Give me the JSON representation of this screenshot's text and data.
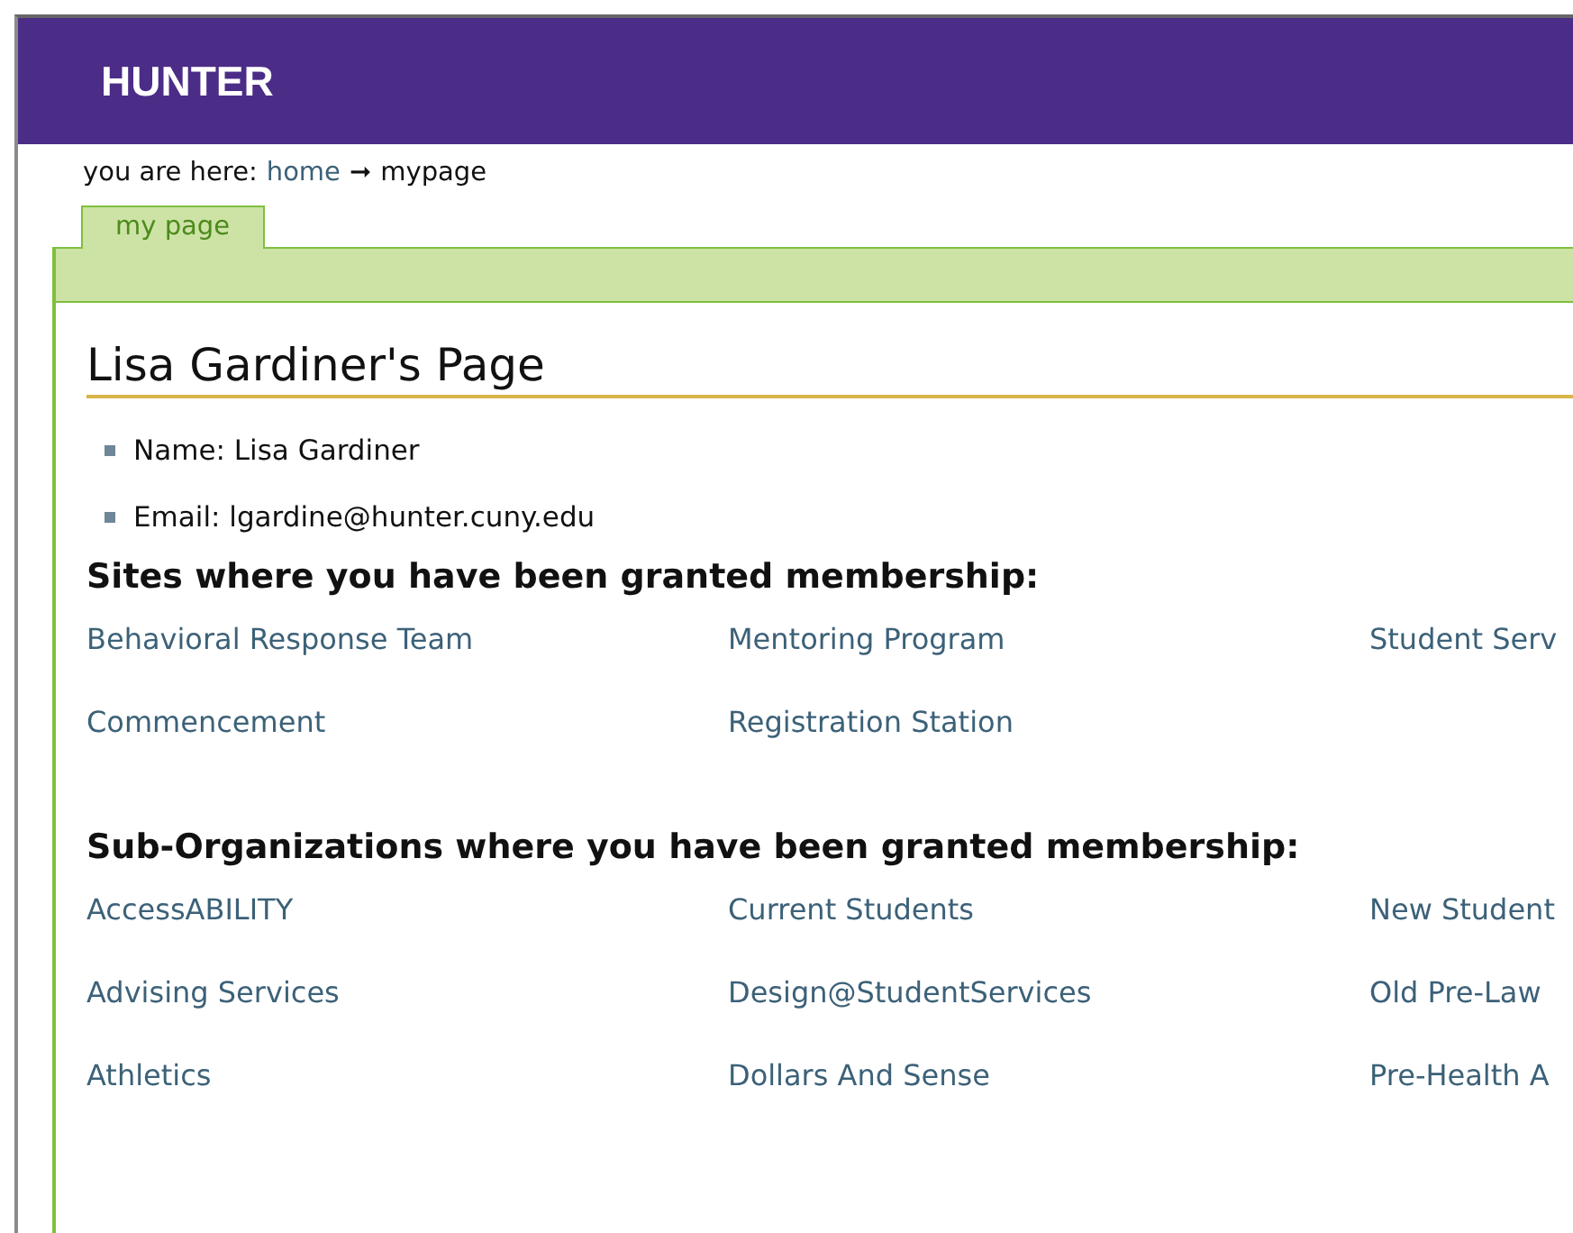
{
  "header": {
    "title": "HUNTER"
  },
  "breadcrumb": {
    "label": "you are here:",
    "items": [
      {
        "text": "home",
        "link": true
      },
      {
        "text": "mypage",
        "link": false
      }
    ],
    "separator": "➞"
  },
  "tabs": [
    {
      "label": "my page",
      "selected": true
    }
  ],
  "profile": {
    "title": "Lisa Gardiner's Page",
    "details": [
      "Name: Lisa Gardiner",
      "Email: lgardine@hunter.cuny.edu"
    ]
  },
  "sections": [
    {
      "heading": "Sites where you have been granted membership:",
      "links": [
        "Behavioral Response Team",
        "Mentoring Program",
        "Student Serv",
        "Commencement",
        "Registration Station"
      ]
    },
    {
      "heading": "Sub-Organizations where you have been granted membership:",
      "links": [
        "AccessABILITY",
        "Current Students",
        "New Student",
        "Advising Services",
        "Design@StudentServices",
        "Old Pre-Law",
        "Athletics",
        "Dollars And Sense",
        "Pre-Health A"
      ]
    }
  ]
}
